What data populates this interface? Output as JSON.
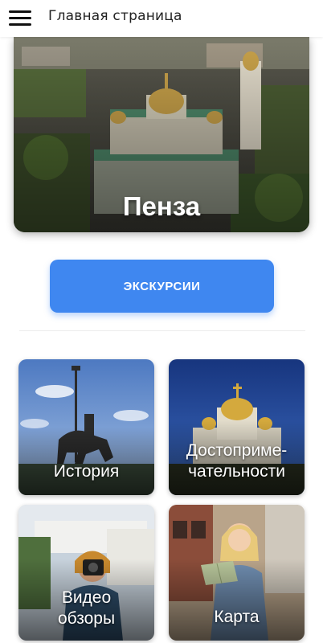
{
  "header": {
    "title": "Главная страница",
    "menu_icon": "hamburger-menu-icon"
  },
  "hero": {
    "city": "Пенза"
  },
  "excursions_button": {
    "label": "ЭКСКУРСИИ",
    "color": "#3f87f0"
  },
  "tiles": [
    {
      "label_line1": "История",
      "label_line2": ""
    },
    {
      "label_line1": "Достоприме-",
      "label_line2": "чательности"
    },
    {
      "label_line1": "Видео",
      "label_line2": "обзоры"
    },
    {
      "label_line1": "Карта",
      "label_line2": ""
    }
  ]
}
